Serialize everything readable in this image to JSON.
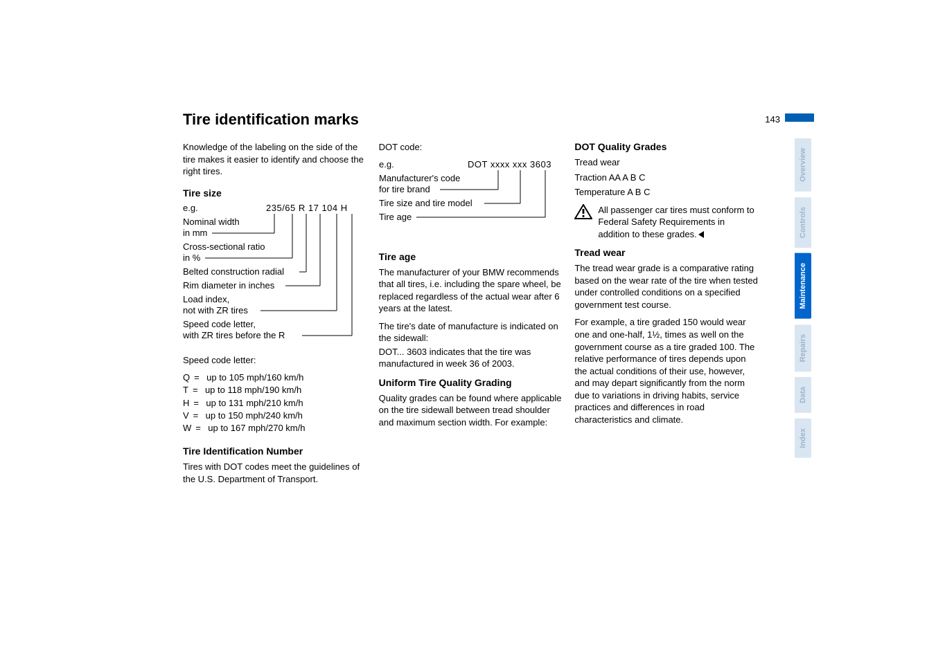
{
  "page_number": "143",
  "title": "Tire identification marks",
  "intro": "Knowledge of the labeling on the side of the tire makes it easier to identify and choose the right tires.",
  "tire_size": {
    "heading": "Tire size",
    "eg": "e.g.",
    "code": "235/65  R  17  104 H",
    "labels": {
      "nominal": "Nominal width\nin mm",
      "cross": "Cross-sectional ratio\nin %",
      "belted": "Belted construction radial",
      "rim": "Rim diameter in inches",
      "load": "Load index,\nnot with ZR tires",
      "speed": "Speed code letter,\nwith ZR tires before the R"
    }
  },
  "speed_letter": {
    "heading": "Speed code letter:",
    "rows": [
      {
        "letter": "Q",
        "text": "up to 105 mph/160 km/h"
      },
      {
        "letter": "T",
        "text": "up to 118 mph/190 km/h"
      },
      {
        "letter": "H",
        "text": "up to 131 mph/210 km/h"
      },
      {
        "letter": "V",
        "text": "up to 150 mph/240 km/h"
      },
      {
        "letter": "W",
        "text": "up to 167 mph/270 km/h"
      }
    ]
  },
  "tin": {
    "heading": "Tire Identification Number",
    "text": "Tires with DOT codes meet the guidelines of the U.S. Department of Transport."
  },
  "dot_code": {
    "heading": "DOT code:",
    "eg": "e.g.",
    "code": "DOT xxxx xxx 3603",
    "labels": {
      "mfr": "Manufacturer's code\nfor tire brand",
      "size": "Tire size and tire model",
      "age": "Tire age"
    }
  },
  "tire_age": {
    "heading": "Tire age",
    "p1": "The manufacturer of your BMW recommends that all tires, i.e. including the spare wheel, be replaced regardless of the actual wear after 6 years at the latest.",
    "p2": "The tire's date of manufacture is indicated on the sidewall:",
    "p3": "DOT... 3603 indicates that the tire was manufactured in week 36 of 2003."
  },
  "uqg": {
    "heading": "Uniform Tire Quality Grading",
    "text": "Quality grades can be found where applicable on the tire sidewall between tread shoulder and maximum section width. For example:"
  },
  "dqg": {
    "heading": "DOT Quality Grades",
    "items": [
      "Tread wear",
      "Traction AA A B C",
      "Temperature A B C"
    ],
    "warn": "All passenger car tires must conform to Federal Safety Requirements in addition to these grades."
  },
  "tread_wear": {
    "heading": "Tread wear",
    "p1": "The tread wear grade is a comparative rating based on the wear rate of the tire when tested under controlled conditions on a specified government test course.",
    "p2": "For example, a tire graded 150 would wear one and one-half, 1½, times as well on the government course as a tire graded 100. The relative performance of tires depends upon the actual conditions of their use, however, and may depart significantly from the norm due to variations in driving habits, service practices and differences in road characteristics and climate."
  },
  "tabs": [
    "Overview",
    "Controls",
    "Maintenance",
    "Repairs",
    "Data",
    "Index"
  ]
}
